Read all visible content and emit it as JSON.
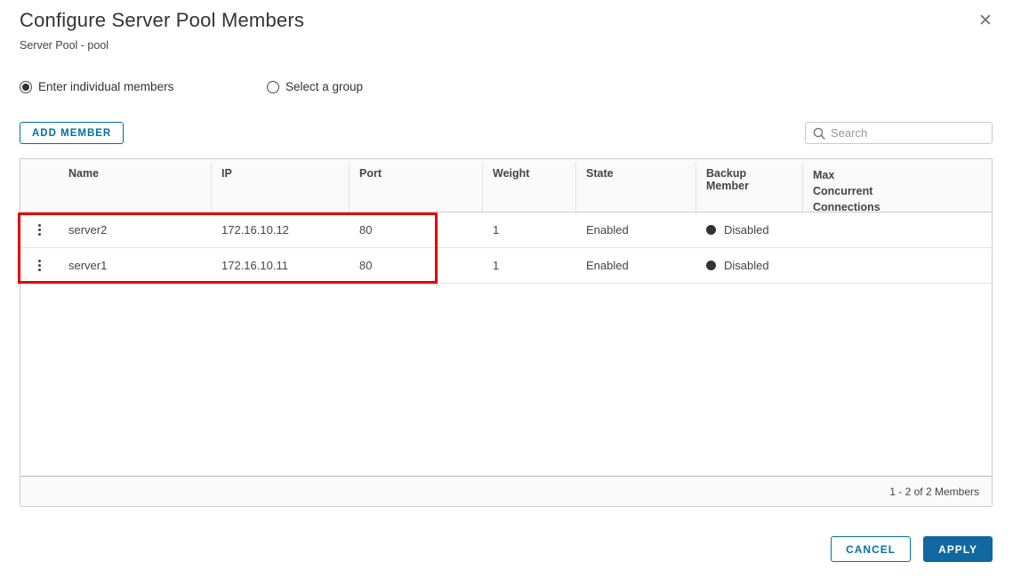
{
  "dialog": {
    "title": "Configure Server Pool Members",
    "subtitle": "Server Pool - pool",
    "close_glyph": "✕"
  },
  "radios": [
    {
      "label": "Enter individual members",
      "selected": true
    },
    {
      "label": "Select a group",
      "selected": false
    }
  ],
  "toolbar": {
    "add_member_label": "ADD MEMBER",
    "search_placeholder": "Search"
  },
  "table": {
    "columns": [
      "Name",
      "IP",
      "Port",
      "Weight",
      "State",
      "Backup Member",
      "Max Concurrent Connections"
    ],
    "rows": [
      {
        "name": "server2",
        "ip": "172.16.10.12",
        "port": "80",
        "weight": "1",
        "state": "Enabled",
        "backup_member": "Disabled",
        "max_concurrent_connections": ""
      },
      {
        "name": "server1",
        "ip": "172.16.10.11",
        "port": "80",
        "weight": "1",
        "state": "Enabled",
        "backup_member": "Disabled",
        "max_concurrent_connections": ""
      }
    ],
    "footer_count": "1 - 2 of 2 Members"
  },
  "actions": {
    "cancel_label": "CANCEL",
    "apply_label": "APPLY"
  },
  "colors": {
    "accent_blue": "#0072a3",
    "apply_button_bg": "#10689e",
    "annotation_red": "#e60000",
    "status_dot": "#333333",
    "header_bg": "#fafafa"
  }
}
